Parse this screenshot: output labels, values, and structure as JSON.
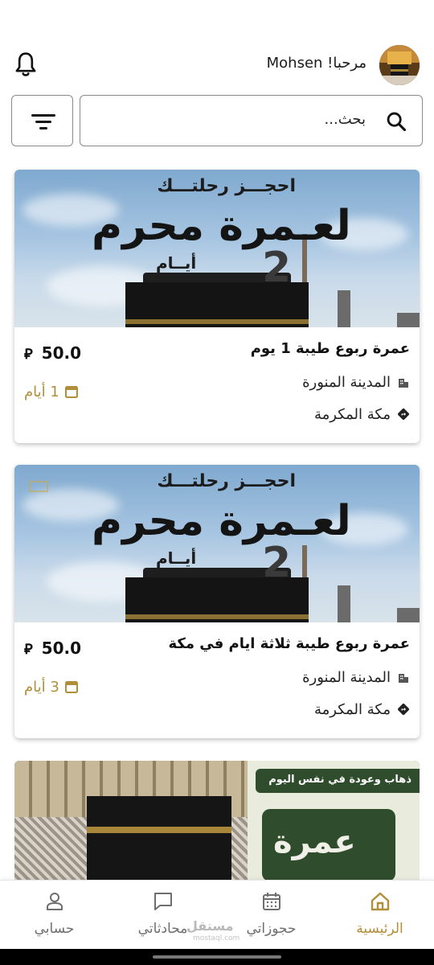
{
  "header": {
    "greeting": "مرحبا! Mohsen"
  },
  "search": {
    "placeholder": "بحث..."
  },
  "trips": [
    {
      "image_line1": "احجـــز رحلتـــك",
      "image_line2": "لعـمرة محرم",
      "image_num": "2",
      "image_days": "أيــام",
      "title": "عمرة ربوع طيبة 1 يوم",
      "price": "50.0",
      "currency": "⃁",
      "city_from": "المدينة المنورة",
      "city_to": "مكة المكرمة",
      "duration": "1 أيام"
    },
    {
      "image_line1": "احجـــز رحلتـــك",
      "image_line2": "لعـمرة محرم",
      "image_num": "2",
      "image_days": "أيــام",
      "title": "عمرة ربوع طيبة ثلاثة ايام في مكة",
      "price": "50.0",
      "currency": "⃁",
      "city_from": "المدينة المنورة",
      "city_to": "مكة المكرمة",
      "duration": "3 أيام"
    },
    {
      "image_strip": "ذهاب وعودة في نفس اليوم",
      "image_word": "عمرة"
    }
  ],
  "nav": {
    "home": "الرئيسية",
    "bookings": "حجوزاتي",
    "chats": "محادثاتي",
    "account": "حسابي"
  },
  "watermark": {
    "main": "مستقل",
    "sub": "mostaql.com"
  },
  "colors": {
    "accent": "#b08e3a",
    "nav_inactive": "#6e6e6e"
  }
}
